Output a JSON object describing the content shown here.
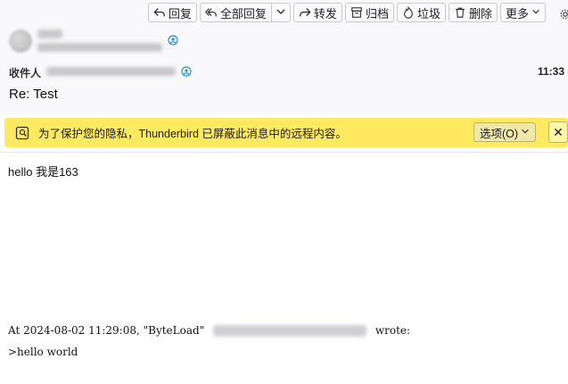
{
  "toolbar": {
    "reply": "回复",
    "reply_all": "全部回复",
    "forward": "转发",
    "archive": "归档",
    "junk": "垃圾",
    "delete": "删除",
    "more": "更多"
  },
  "header": {
    "to_label": "收件人",
    "time": "11:33",
    "subject": "Re: Test"
  },
  "notification": {
    "message": "为了保护您的隐私，Thunderbird 已屏蔽此消息中的远程内容。",
    "options_label": "选项(O)",
    "close_label": "✕"
  },
  "message": {
    "greeting": "hello 我是163",
    "quote_prefix": "At 2024-08-02 11:29:08, \"ByteLoad\"",
    "quote_suffix": "wrote:",
    "quoted_text": ">hello world"
  },
  "colors": {
    "notification_bg": "#ffe961",
    "header_bg": "#f9f9fb",
    "contact_icon": "#2b8fd6"
  }
}
